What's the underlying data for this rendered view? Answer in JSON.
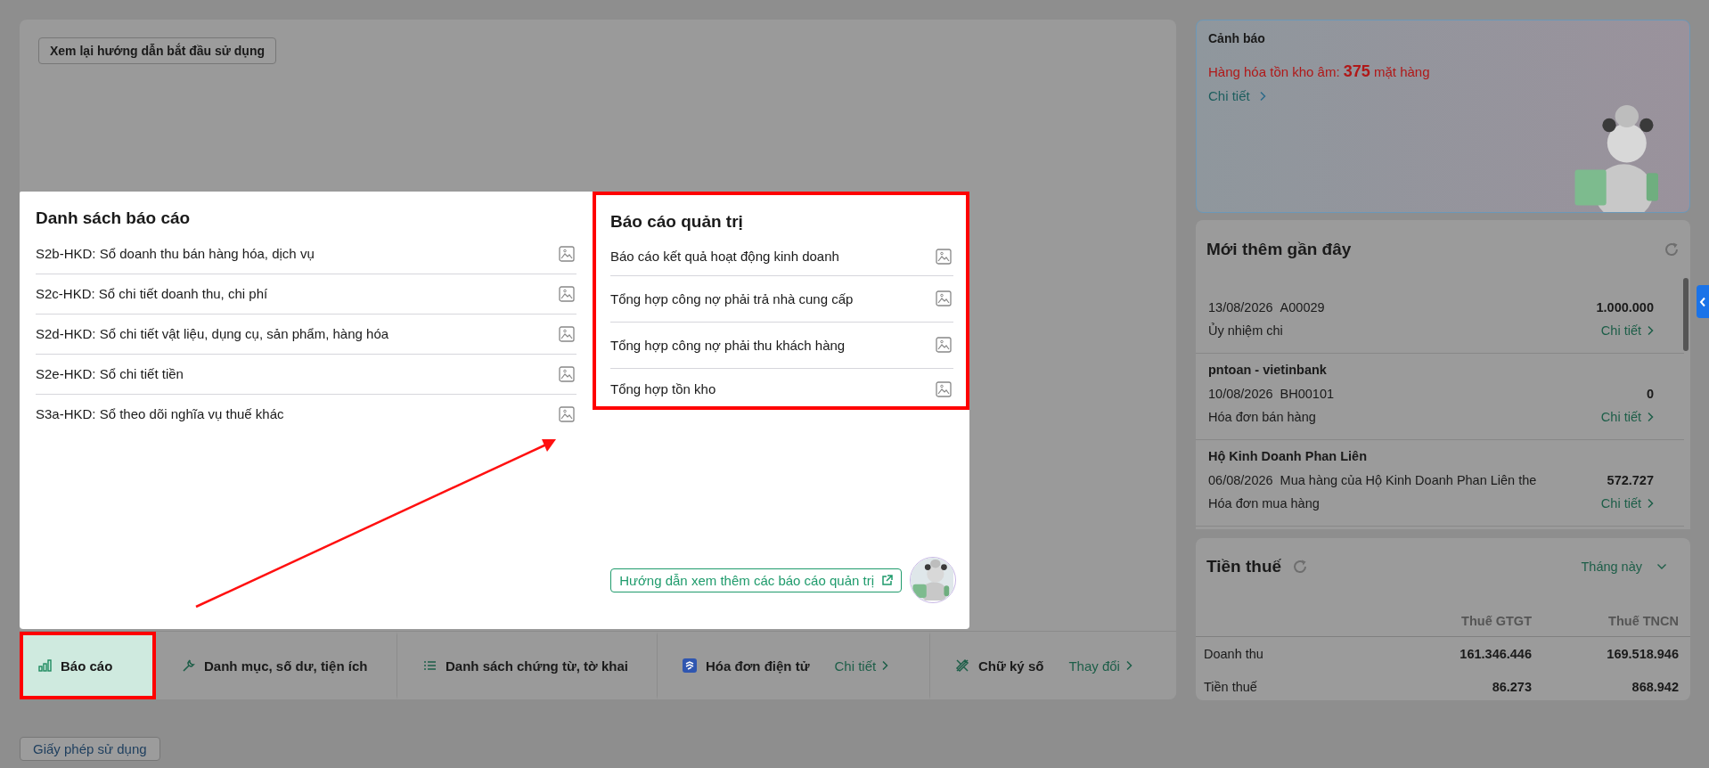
{
  "onboarding_button": "Xem lại hướng dẫn bắt đầu sử dụng",
  "popup": {
    "left": {
      "title": "Danh sách báo cáo",
      "items": [
        "S2b-HKD: Sổ doanh thu bán hàng hóa, dịch vụ",
        "S2c-HKD: Sổ chi tiết doanh thu, chi phí",
        "S2d-HKD: Sổ chi tiết vật liệu, dụng cụ, sản phẩm, hàng hóa",
        "S2e-HKD: Sổ chi tiết tiền",
        "S3a-HKD: Sổ theo dõi nghĩa vụ thuế khác"
      ]
    },
    "right": {
      "title": "Báo cáo quản trị",
      "highlighted": true,
      "items": [
        "Báo cáo kết quả hoạt động kinh doanh",
        "Tổng hợp công nợ phải trả nhà cung cấp",
        "Tổng hợp công nợ phải thu khách hàng",
        "Tổng hợp tồn kho"
      ]
    },
    "guide_link": "Hướng dẫn xem thêm các báo cáo quản trị"
  },
  "feature_tabs": [
    {
      "label": "Báo cáo",
      "selected": true,
      "highlighted": true
    },
    {
      "label": "Danh mục, số dư, tiện ích",
      "selected": false,
      "highlighted": false
    },
    {
      "label": "Danh sách chứng từ, tờ khai",
      "selected": false,
      "highlighted": false
    },
    {
      "label": "Hóa đơn điện tử",
      "selected": false,
      "highlighted": false,
      "link": "Chi tiết"
    },
    {
      "label": "Chữ ký số",
      "selected": false,
      "highlighted": false,
      "link": "Thay đổi"
    }
  ],
  "license_button": "Giấy phép sử dụng",
  "alert": {
    "title": "Cảnh báo",
    "message": "Hàng hóa tồn kho âm: **375** mặt hàng",
    "link": "Chi tiết"
  },
  "recent": {
    "title": "Mới thêm gần đây",
    "items": [
      {
        "date": "13/08/2026",
        "reference": "A00029",
        "amount": "1.000.000",
        "type": "Ủy nhiệm chi",
        "link": "Chi tiết"
      },
      {
        "partner": "pntoan - vietinbank",
        "date": "10/08/2026",
        "reference": "BH00101",
        "amount": "0",
        "type": "Hóa đơn bán hàng",
        "link": "Chi tiết"
      },
      {
        "partner": "Hộ Kinh Doanh Phan Liên",
        "date": "06/08/2026",
        "reference": "Mua hàng của Hộ Kinh Doanh Phan Liên the",
        "amount": "572.727",
        "type": "Hóa đơn mua hàng",
        "link": "Chi tiết"
      }
    ]
  },
  "tax": {
    "title": "Tiền thuế",
    "period": "Tháng này",
    "columns": [
      "Thuế GTGT",
      "Thuế TNCN"
    ],
    "rows": [
      {
        "label": "Doanh thu",
        "values": [
          "161.346.446",
          "169.518.946"
        ]
      },
      {
        "label": "Tiền thuế",
        "values": [
          "86.273",
          "868.942"
        ]
      }
    ]
  }
}
